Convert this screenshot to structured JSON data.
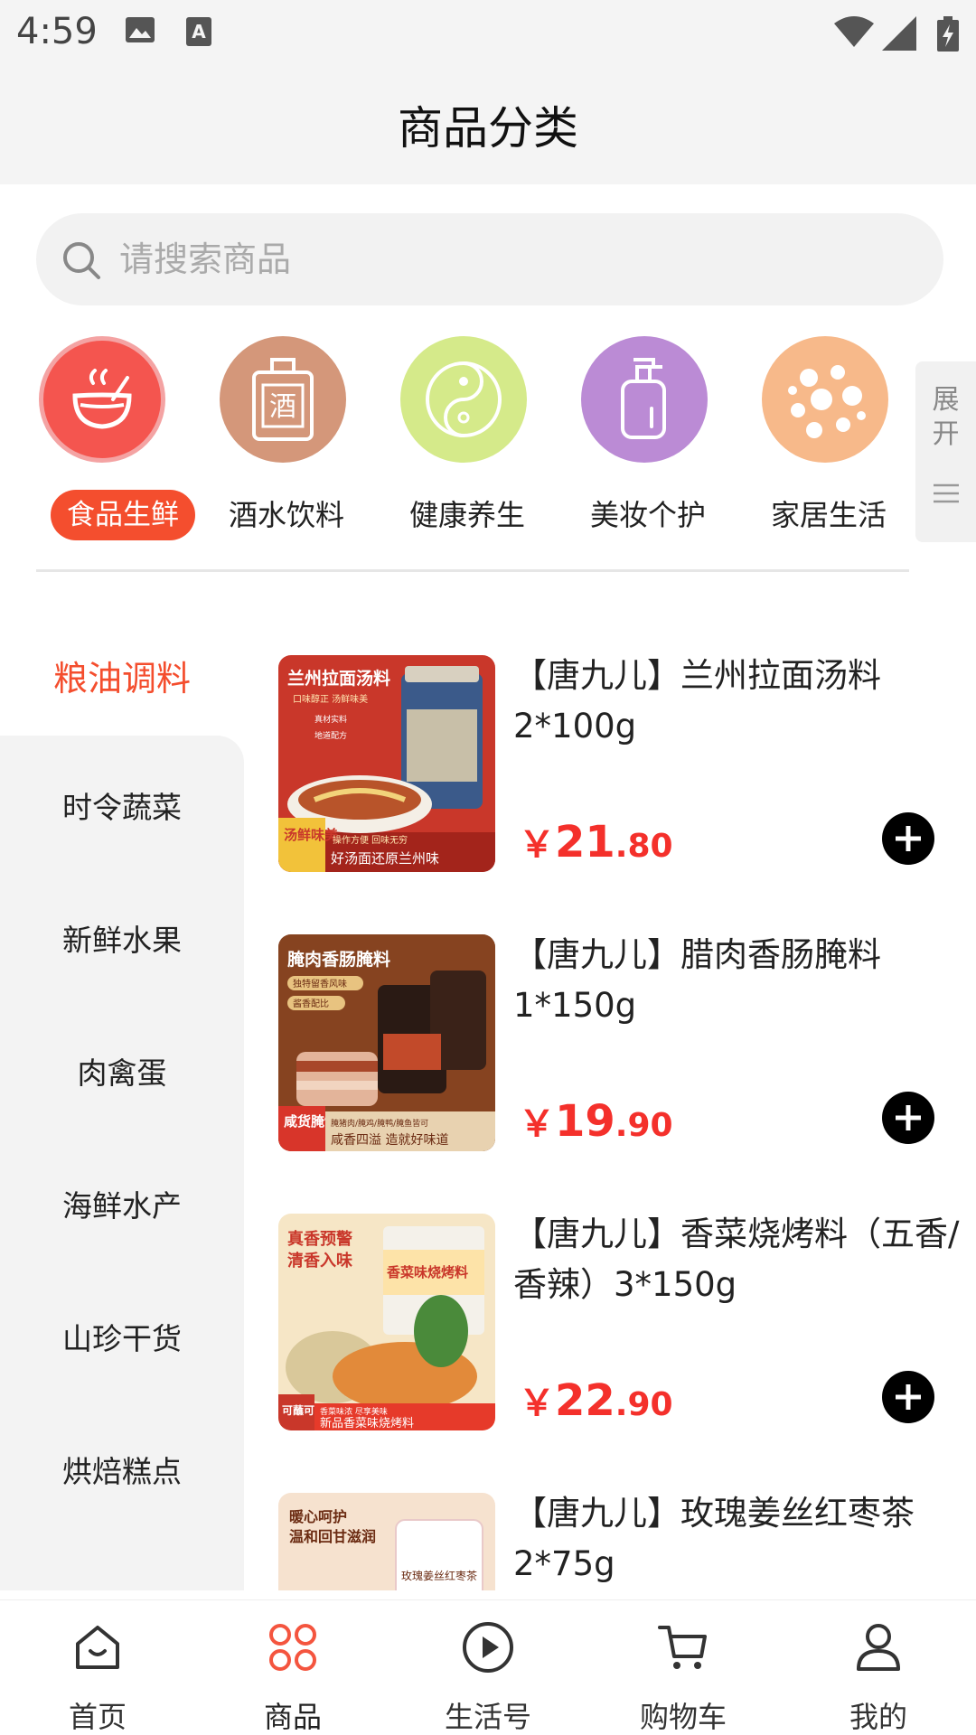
{
  "status_bar": {
    "time": "4:59"
  },
  "header": {
    "title": "商品分类"
  },
  "search": {
    "placeholder": "请搜索商品"
  },
  "top_categories": [
    {
      "label": "食品生鲜",
      "color": "#f4554f",
      "icon": "soup-bowl-icon",
      "active": true
    },
    {
      "label": "酒水饮料",
      "color": "#d4977a",
      "icon": "wine-jar-icon"
    },
    {
      "label": "健康养生",
      "color": "#d5ea8a",
      "icon": "yin-yang-icon"
    },
    {
      "label": "美妆个护",
      "color": "#bb8bd5",
      "icon": "lotion-bottle-icon"
    },
    {
      "label": "家居生活",
      "color": "#f7b98a",
      "icon": "dots-network-icon"
    }
  ],
  "expand": {
    "label": "展开"
  },
  "sidebar": {
    "active": "粮油调料",
    "items": [
      "时令蔬菜",
      "新鲜水果",
      "肉禽蛋",
      "海鲜水产",
      "山珍干货",
      "烘焙糕点"
    ]
  },
  "products": [
    {
      "name": "【唐九儿】兰州拉面汤料 2*100g",
      "price_symbol": "￥",
      "price_int": "21",
      "price_dec": ".80"
    },
    {
      "name": "【唐九儿】腊肉香肠腌料 1*150g",
      "price_symbol": "￥",
      "price_int": "19",
      "price_dec": ".90"
    },
    {
      "name": "【唐九儿】香菜烧烤料（五香/香辣）3*150g",
      "price_symbol": "￥",
      "price_int": "22",
      "price_dec": ".90"
    },
    {
      "name": "【唐九儿】玫瑰姜丝红枣茶 2*75g",
      "price_symbol": "￥",
      "price_int": "",
      "price_dec": ""
    }
  ],
  "thumb_text": {
    "p1_title": "兰州拉面汤料",
    "p1_sub": "口味醇正 汤鲜味美",
    "p1_tag1": "真材实料",
    "p1_tag2": "地道配方",
    "p1_badge": "汤鲜味美",
    "p1_slogan1": "操作方便 回味无穷",
    "p1_slogan2": "好汤面还原兰州味",
    "p2_title": "腌肉香肠腌料",
    "p2_tag1": "独特留香风味",
    "p2_tag2": "酱香配比",
    "p2_badge": "咸货腌制",
    "p2_slogan1": "腌猪肉/腌鸡/腌鸭/腌鱼皆可",
    "p2_slogan2": "咸香四溢 造就好味道",
    "p3_title1": "真香预警",
    "p3_title2": "清香入味",
    "p3_jar": "香菜味烧烤料",
    "p3_badge": "可蘸可撒",
    "p3_slogan1": "香菜味浓 尽享美味",
    "p3_slogan2": "新品香菜味烧烤料",
    "p4_title1": "暖心呵护",
    "p4_title2": "温和回甘滋润",
    "p4_jar": "玫瑰姜丝红枣茶"
  },
  "bottom_nav": [
    {
      "label": "首页",
      "icon": "home-icon"
    },
    {
      "label": "商品",
      "icon": "category-grid-icon",
      "active": true,
      "color": "#f4553f"
    },
    {
      "label": "生活号",
      "icon": "play-circle-icon"
    },
    {
      "label": "购物车",
      "icon": "cart-icon"
    },
    {
      "label": "我的",
      "icon": "user-icon"
    }
  ]
}
